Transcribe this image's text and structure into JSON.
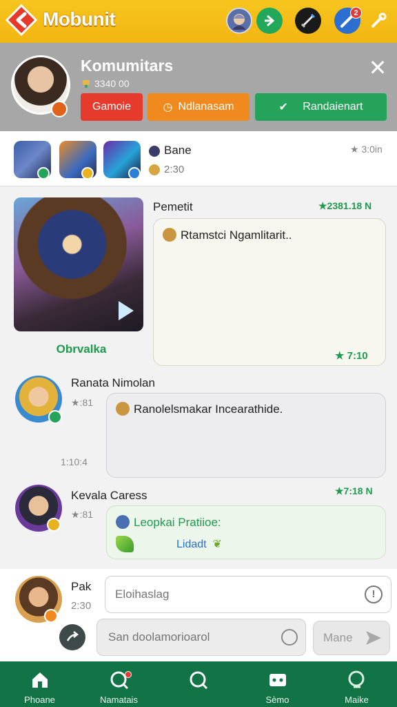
{
  "app": {
    "title": "Mobunit"
  },
  "colors": {
    "topbar": "#f2b512",
    "banner": "#a7a7a7",
    "accent_green": "#1f9a4e",
    "nav_bg": "#117346",
    "red": "#e53a2c",
    "orange": "#f08a1e"
  },
  "top_icons": [
    {
      "name": "profile-avatar-icon"
    },
    {
      "name": "add-icon"
    },
    {
      "name": "sword-icon"
    },
    {
      "name": "messages-icon",
      "badge": "2"
    },
    {
      "name": "tool-icon"
    }
  ],
  "banner": {
    "title": "Komumitars",
    "subtitle": "3340 00",
    "buttons": {
      "red": "Gamoie",
      "orange": "Ndlanasam",
      "green": "Randaienart"
    }
  },
  "online": {
    "name": "Bane",
    "time": "2:30",
    "stamp": "★ 3:0in"
  },
  "post": {
    "author": "Pemetit",
    "stamp": "★2381.18 N",
    "caption": "Obrvalka",
    "message": "Rtamstci Ngamlitarit..",
    "time": "★ 7:10"
  },
  "comment1": {
    "name": "Ranata Nimolan",
    "side_top": "★:81",
    "side_bottom": "1:10:4",
    "message": "Ranolelsmakar Incearathide."
  },
  "comment2": {
    "name": "Kevala Caress",
    "side_top": "★:81",
    "stamp": "★7:18 N",
    "message": "Leopkai Pratiioe:",
    "link": "Lidadt"
  },
  "composer": {
    "name": "Pak",
    "time": "2:30",
    "input1_placeholder": "Eloihaslag",
    "input2_placeholder": "San doolamorioarol",
    "send_label": "Mane"
  },
  "nav": [
    {
      "label": "Phoane",
      "icon": "home-icon"
    },
    {
      "label": "Namatais",
      "icon": "notifications-icon"
    },
    {
      "label": "",
      "icon": "search-icon"
    },
    {
      "label": "Sèmo",
      "icon": "gamepad-icon"
    },
    {
      "label": "Maike",
      "icon": "search-alt-icon"
    }
  ]
}
